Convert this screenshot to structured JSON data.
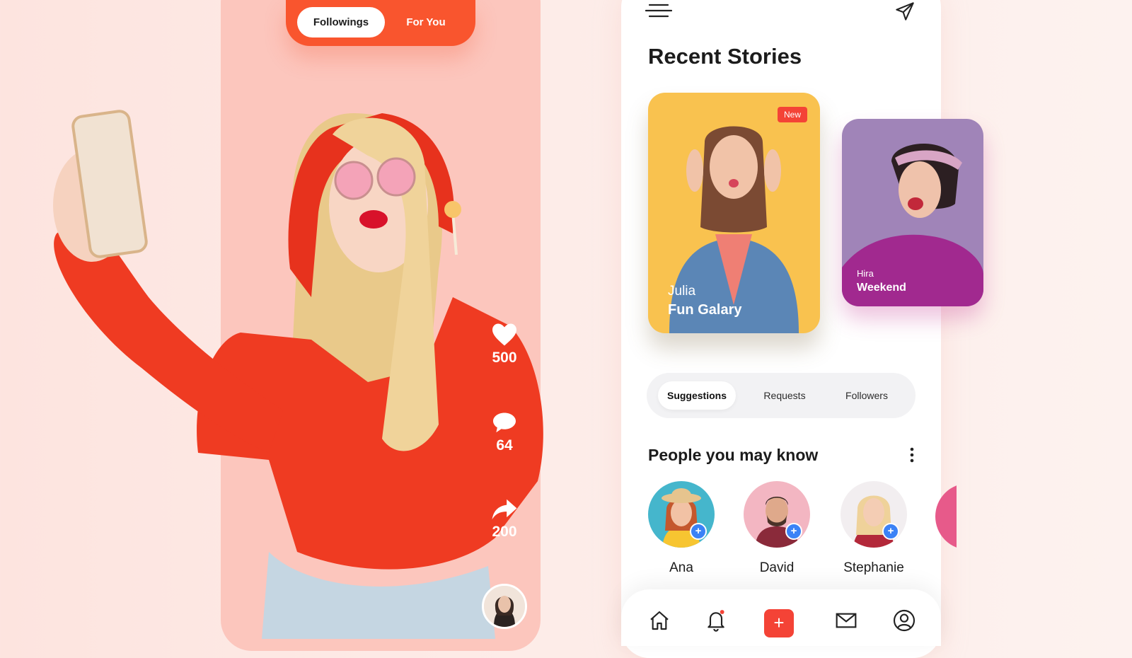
{
  "feed": {
    "tabs": [
      {
        "label": "Followings",
        "active": true
      },
      {
        "label": "For You",
        "active": false
      }
    ],
    "likes": "500",
    "comments": "64",
    "shares": "200"
  },
  "right": {
    "stories_title": "Recent Stories",
    "stories": [
      {
        "user": "Julia",
        "title": "Fun Galary",
        "badge": "New"
      },
      {
        "user": "Hira",
        "title": "Weekend"
      }
    ],
    "segment": [
      {
        "label": "Suggestions",
        "active": true
      },
      {
        "label": "Requests",
        "active": false
      },
      {
        "label": "Followers",
        "active": false
      }
    ],
    "people_title": "People you may know",
    "people": [
      {
        "name": "Ana"
      },
      {
        "name": "David"
      },
      {
        "name": "Stephanie"
      }
    ],
    "nav_add_symbol": "+"
  },
  "colors": {
    "accent": "#f9552e",
    "red": "#f44336",
    "blue_add": "#3b82f6",
    "left_phone_bg": "#fcc6bd",
    "julia_story_bg": "#f9c24f",
    "hira_story_bg": "#a084b8"
  },
  "icons": [
    "menu-icon",
    "send-icon",
    "heart-icon",
    "comment-icon",
    "share-icon",
    "more-icon",
    "home-icon",
    "bell-icon",
    "plus-icon",
    "mail-icon",
    "profile-icon"
  ]
}
